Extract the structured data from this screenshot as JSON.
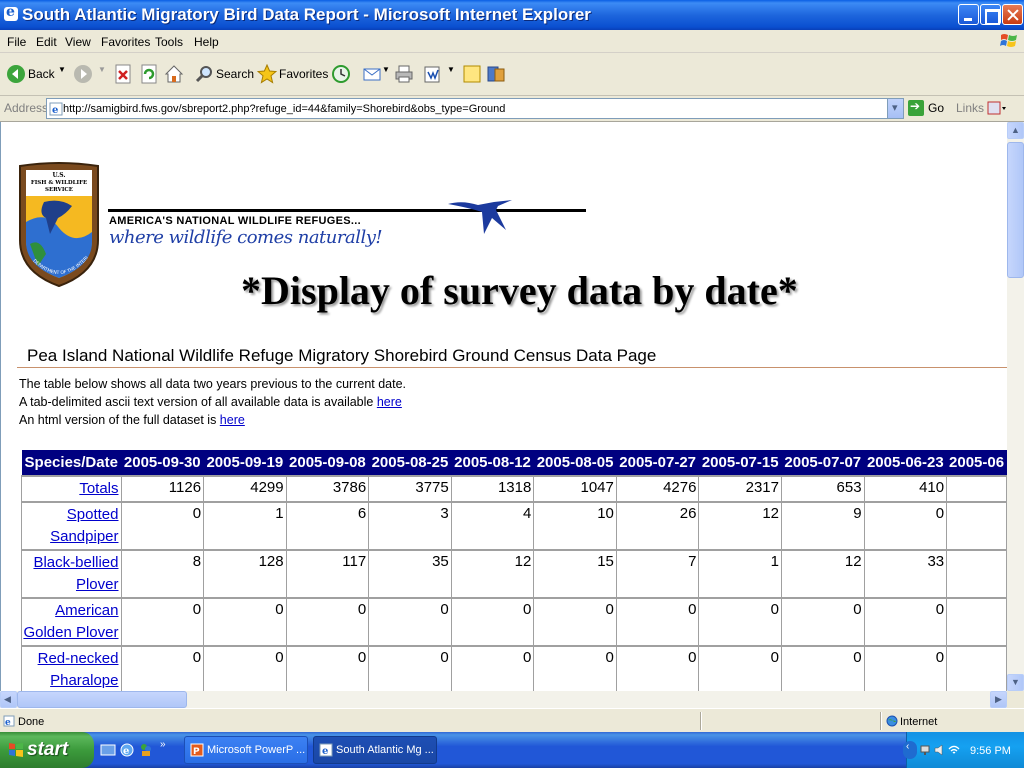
{
  "window": {
    "title": "South Atlantic Migratory Bird Data Report - Microsoft Internet Explorer"
  },
  "menu": [
    "File",
    "Edit",
    "View",
    "Favorites",
    "Tools",
    "Help"
  ],
  "toolbar": {
    "back": "Back",
    "search": "Search",
    "favorites": "Favorites"
  },
  "address": {
    "label": "Address",
    "url": "http://samigbird.fws.gov/sbreport2.php?refuge_id=44&family=Shorebird&obs_type=Ground",
    "go": "Go",
    "links": "Links"
  },
  "page": {
    "logo_text": [
      "U.S.",
      "FISH & WILDLIFE",
      "SERVICE",
      "DEPARTMENT OF THE INTERIOR"
    ],
    "tagline": "AMERICA'S NATIONAL WILDLIFE REFUGES...",
    "tagline2": "where wildlife comes naturally!",
    "headline": "*Display of survey data by date*",
    "subtitle": "Pea Island National Wildlife Refuge Migratory Shorebird Ground Census Data Page",
    "intro": [
      {
        "text": "The table below shows all data two years previous to the current date.",
        "link": ""
      },
      {
        "text": "A tab-delimited ascii text version of all available data is available ",
        "link": "here"
      },
      {
        "text": "An html version of the full dataset is ",
        "link": "here"
      }
    ]
  },
  "table": {
    "header_first": "Species/Date",
    "dates": [
      "2005-09-30",
      "2005-09-19",
      "2005-09-08",
      "2005-08-25",
      "2005-08-12",
      "2005-08-05",
      "2005-07-27",
      "2005-07-15",
      "2005-07-07",
      "2005-06-23",
      "2005-06"
    ],
    "rows": [
      {
        "species": "Totals",
        "values": [
          "1126",
          "4299",
          "3786",
          "3775",
          "1318",
          "1047",
          "4276",
          "2317",
          "653",
          "410",
          ""
        ]
      },
      {
        "species": "Spotted Sandpiper",
        "values": [
          "0",
          "1",
          "6",
          "3",
          "4",
          "10",
          "26",
          "12",
          "9",
          "0",
          ""
        ]
      },
      {
        "species": "Black-bellied Plover",
        "values": [
          "8",
          "128",
          "117",
          "35",
          "12",
          "15",
          "7",
          "1",
          "12",
          "33",
          ""
        ]
      },
      {
        "species": "American Golden Plover",
        "values": [
          "0",
          "0",
          "0",
          "0",
          "0",
          "0",
          "0",
          "0",
          "0",
          "0",
          ""
        ]
      },
      {
        "species": "Red-necked Pharalope",
        "values": [
          "0",
          "0",
          "0",
          "0",
          "0",
          "0",
          "0",
          "0",
          "0",
          "0",
          ""
        ]
      }
    ]
  },
  "status": {
    "text": "Done",
    "zone": "Internet"
  },
  "taskbar": {
    "start": "start",
    "tasks": [
      "Microsoft PowerP ...",
      "South Atlantic Mg ..."
    ],
    "clock": "9:56 PM"
  },
  "colors": {
    "header_bg": "#000080",
    "link": "#0000cc",
    "titlebar": "#0a4fd0"
  }
}
